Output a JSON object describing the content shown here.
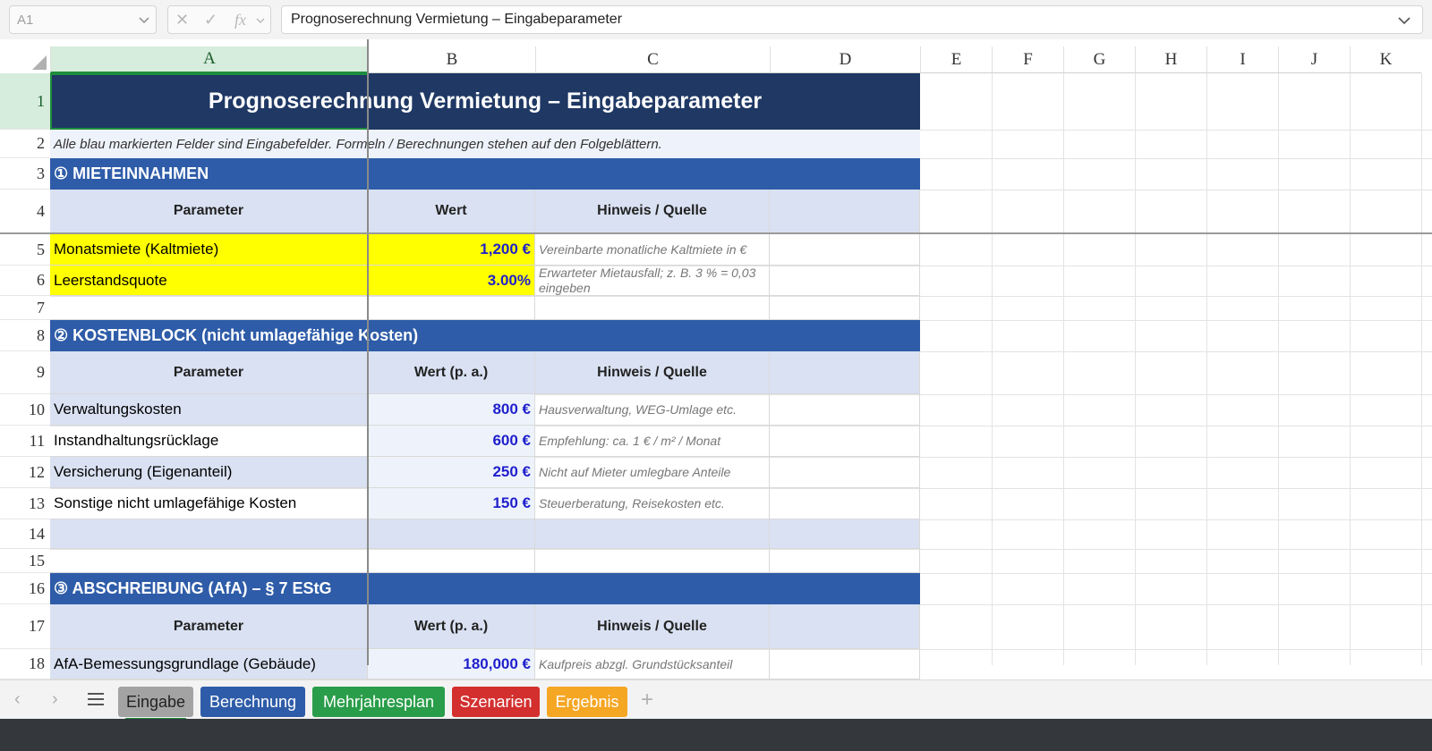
{
  "formula_bar": {
    "cell_ref": "A1",
    "formula": "Prognoserechnung Vermietung – Eingabeparameter",
    "fx_label": "fx"
  },
  "columns": [
    "A",
    "B",
    "C",
    "D",
    "E",
    "F",
    "G",
    "H",
    "I",
    "J",
    "K"
  ],
  "rows": [
    "1",
    "2",
    "3",
    "4",
    "5",
    "6",
    "7",
    "8",
    "9",
    "10",
    "11",
    "12",
    "13",
    "14",
    "15",
    "16",
    "17",
    "18"
  ],
  "sheet": {
    "title": "Prognoserechnung Vermietung – Eingabeparameter",
    "note": "Alle blau markierten Felder sind Eingabefelder. Formeln / Berechnungen stehen auf den Folgeblättern.",
    "section1": {
      "heading": "① MIETEINNAHMEN",
      "col_param": "Parameter",
      "col_value": "Wert",
      "col_hint": "Hinweis / Quelle",
      "rows": [
        {
          "label": "Monatsmiete (Kaltmiete)",
          "value": "1,200 €",
          "hint": "Vereinbarte monatliche Kaltmiete in €"
        },
        {
          "label": "Leerstandsquote",
          "value": "3.00%",
          "hint": "Erwarteter Mietausfall; z. B. 3 % = 0,03 eingeben"
        }
      ]
    },
    "section2": {
      "heading": "② KOSTENBLOCK (nicht umlagefähige Kosten)",
      "col_param": "Parameter",
      "col_value": "Wert (p. a.)",
      "col_hint": "Hinweis / Quelle",
      "rows": [
        {
          "label": "Verwaltungskosten",
          "value": "800 €",
          "hint": "Hausverwaltung, WEG-Umlage etc."
        },
        {
          "label": "Instandhaltungsrücklage",
          "value": "600 €",
          "hint": "Empfehlung: ca. 1 € / m² / Monat"
        },
        {
          "label": "Versicherung (Eigenanteil)",
          "value": "250 €",
          "hint": "Nicht auf Mieter umlegbare Anteile"
        },
        {
          "label": "Sonstige nicht umlagefähige Kosten",
          "value": "150 €",
          "hint": "Steuerberatung, Reisekosten etc."
        }
      ]
    },
    "section3": {
      "heading": "③ ABSCHREIBUNG (AfA) – § 7 EStG",
      "col_param": "Parameter",
      "col_value": "Wert (p. a.)",
      "col_hint": "Hinweis / Quelle",
      "rows": [
        {
          "label": "AfA-Bemessungsgrundlage (Gebäude)",
          "value": "180,000 €",
          "hint": "Kaufpreis abzgl. Grundstücksanteil"
        }
      ]
    }
  },
  "tabs": [
    {
      "label": "Eingabe",
      "color": "#a3a3a3",
      "active": true
    },
    {
      "label": "Berechnung",
      "color": "#2e5ca8"
    },
    {
      "label": "Mehrjahresplan",
      "color": "#2a9d4a"
    },
    {
      "label": "Szenarien",
      "color": "#d32f2f"
    },
    {
      "label": "Ergebnis",
      "color": "#f5a623"
    }
  ],
  "colors": {
    "title_band": "#1f3864",
    "section_band": "#2e5ca8",
    "header_fill": "#d9e1f2",
    "input_fill": "#ffff00",
    "value_text": "#1f1fcc",
    "selection": "#1e8e3e"
  },
  "icons": [
    "chevron-down-icon",
    "cancel-icon",
    "confirm-icon",
    "function-icon",
    "sheet-menu-icon",
    "add-sheet-icon",
    "prev-sheet-icon",
    "next-sheet-icon"
  ]
}
